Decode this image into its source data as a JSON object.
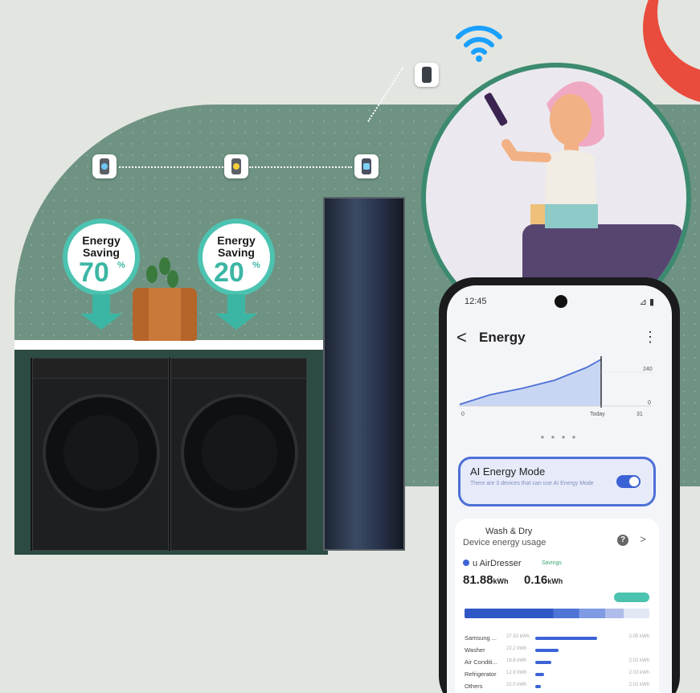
{
  "bubbles": [
    {
      "line1": "Energy",
      "line2": "Saving",
      "percent": "70",
      "unit": "%"
    },
    {
      "line1": "Energy",
      "line2": "Saving",
      "percent": "20",
      "unit": "%"
    }
  ],
  "phone": {
    "status_time": "12:45",
    "status_icons": "⊿ ▮",
    "back_symbol": "<",
    "title": "Energy",
    "more_symbol": "⋮",
    "chart": {
      "x_labels": [
        "0",
        "Today",
        "31"
      ],
      "y_labels": [
        "240",
        "0"
      ]
    },
    "pager": "● ● ● ●",
    "ai_mode": {
      "title": "AI Energy Mode",
      "subtitle": "There are 3 devices that can use AI Energy Mode",
      "toggle_on": true
    },
    "wash_dry": {
      "title": "Wash & Dry",
      "subtitle": "Device energy usage",
      "help_symbol": "?",
      "chevron_symbol": ">",
      "device_name": "AirDresser",
      "device_prefix": "u",
      "savings_label": "Savings",
      "usage_value": "81.88",
      "usage_unit": "kWh",
      "savings_value": "0.16",
      "savings_unit": "kWh",
      "rows": [
        {
          "name": "Samsung ...",
          "small": "27.53 kWh",
          "fraction": 0.85,
          "value": "2.05 kWh"
        },
        {
          "name": "Washer",
          "small": "22.2 kWh",
          "fraction": 0.32,
          "value": ""
        },
        {
          "name": "Air Conditi...",
          "small": "18.8 kWh",
          "fraction": 0.22,
          "value": "2.02 kWh"
        },
        {
          "name": "Refrigerator",
          "small": "12.9 kWh",
          "fraction": 0.12,
          "value": "2.03 kWh"
        },
        {
          "name": "Others",
          "small": "22.0 kWh",
          "fraction": 0.08,
          "value": "2.02 kWh"
        }
      ]
    }
  },
  "colors": {
    "teal": "#3cb6a4",
    "blue": "#3c63d6",
    "green_panel": "#6f9383",
    "red": "#e94c3d"
  }
}
